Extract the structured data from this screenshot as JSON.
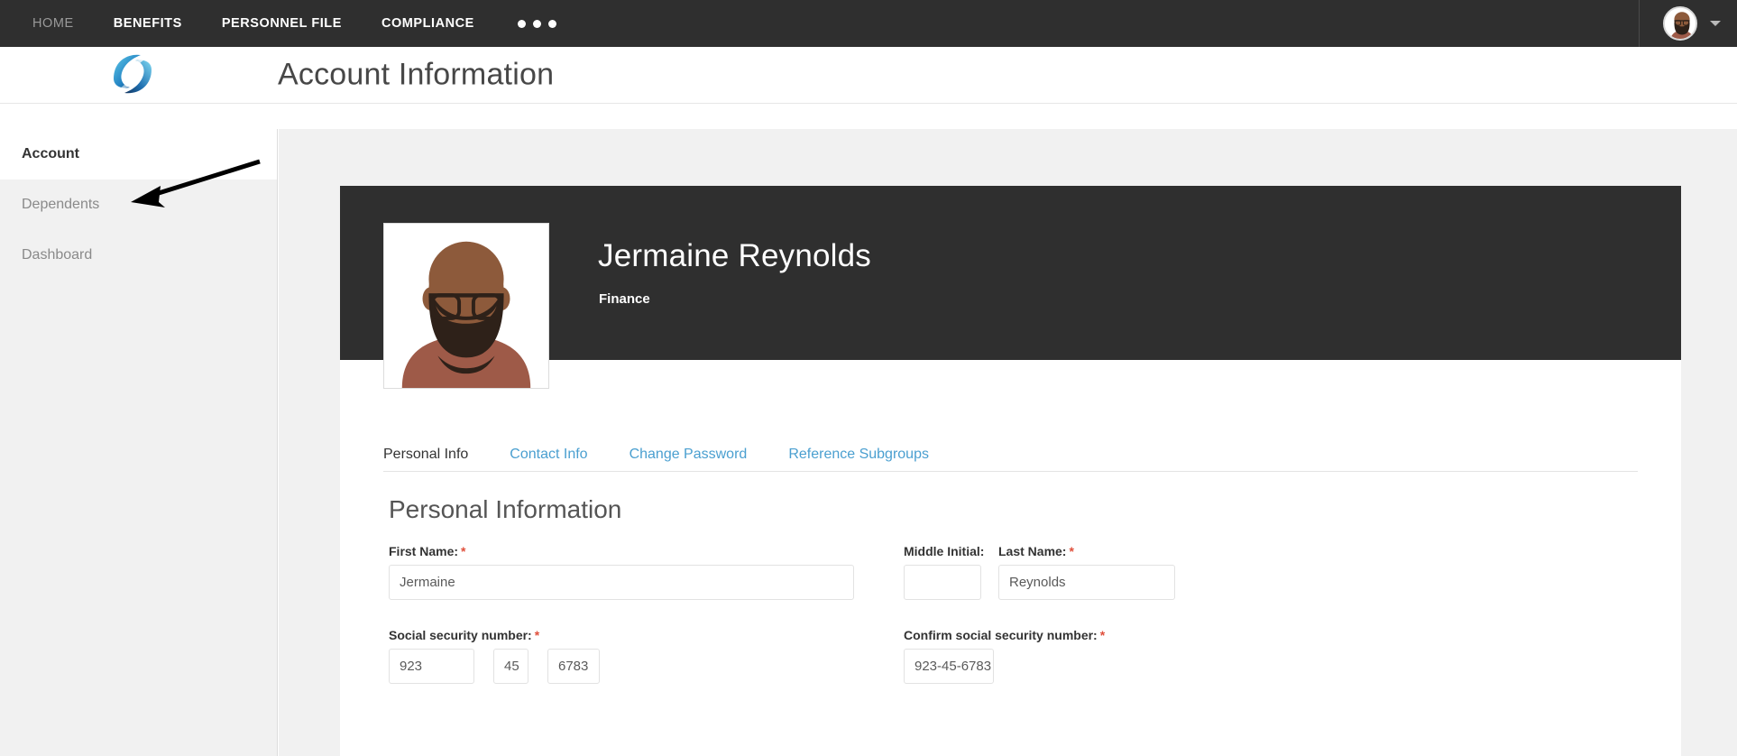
{
  "topnav": {
    "items": [
      {
        "label": "HOME",
        "active": false
      },
      {
        "label": "BENEFITS",
        "active": true
      },
      {
        "label": "PERSONNEL FILE",
        "active": true
      },
      {
        "label": "COMPLIANCE",
        "active": true
      }
    ],
    "overflow_icon": "ellipsis-icon",
    "avatar_icon": "user-avatar-icon",
    "caret_icon": "chevron-down-icon"
  },
  "header": {
    "logo_icon": "company-swirl-logo-icon",
    "title": "Account Information"
  },
  "sidebar": {
    "items": [
      {
        "label": "Account",
        "active": true
      },
      {
        "label": "Dependents",
        "active": false
      },
      {
        "label": "Dashboard",
        "active": false
      }
    ]
  },
  "annotation": {
    "arrow_icon": "pointer-arrow-icon",
    "target": "Dependents"
  },
  "profile": {
    "photo_icon": "employee-portrait-icon",
    "name": "Jermaine Reynolds",
    "department": "Finance"
  },
  "tabs": [
    {
      "label": "Personal Info",
      "active": true
    },
    {
      "label": "Contact Info",
      "active": false
    },
    {
      "label": "Change Password",
      "active": false
    },
    {
      "label": "Reference Subgroups",
      "active": false
    }
  ],
  "form": {
    "section_title": "Personal Information",
    "first_name": {
      "label": "First Name:",
      "required": "*",
      "value": "Jermaine",
      "placeholder": "First Name"
    },
    "middle_initial": {
      "label": "Middle Initial:",
      "required": "",
      "value": "",
      "placeholder": ""
    },
    "last_name": {
      "label": "Last Name:",
      "required": "*",
      "value": "Reynolds",
      "placeholder": "Last Name"
    },
    "ssn": {
      "label": "Social security number:",
      "required": "*",
      "part1": "923",
      "part2": "45",
      "part3": "6783"
    },
    "confirm_ssn": {
      "label": "Confirm social security number:",
      "required": "*",
      "value": "923-45-6783",
      "placeholder": ""
    }
  },
  "colors": {
    "nav_bg": "#2f2f2f",
    "page_bg": "#f1f1f1",
    "link_blue": "#4a9fd0",
    "required_red": "#e0503c",
    "card_bg": "#ffffff",
    "text_dark": "#333333"
  }
}
